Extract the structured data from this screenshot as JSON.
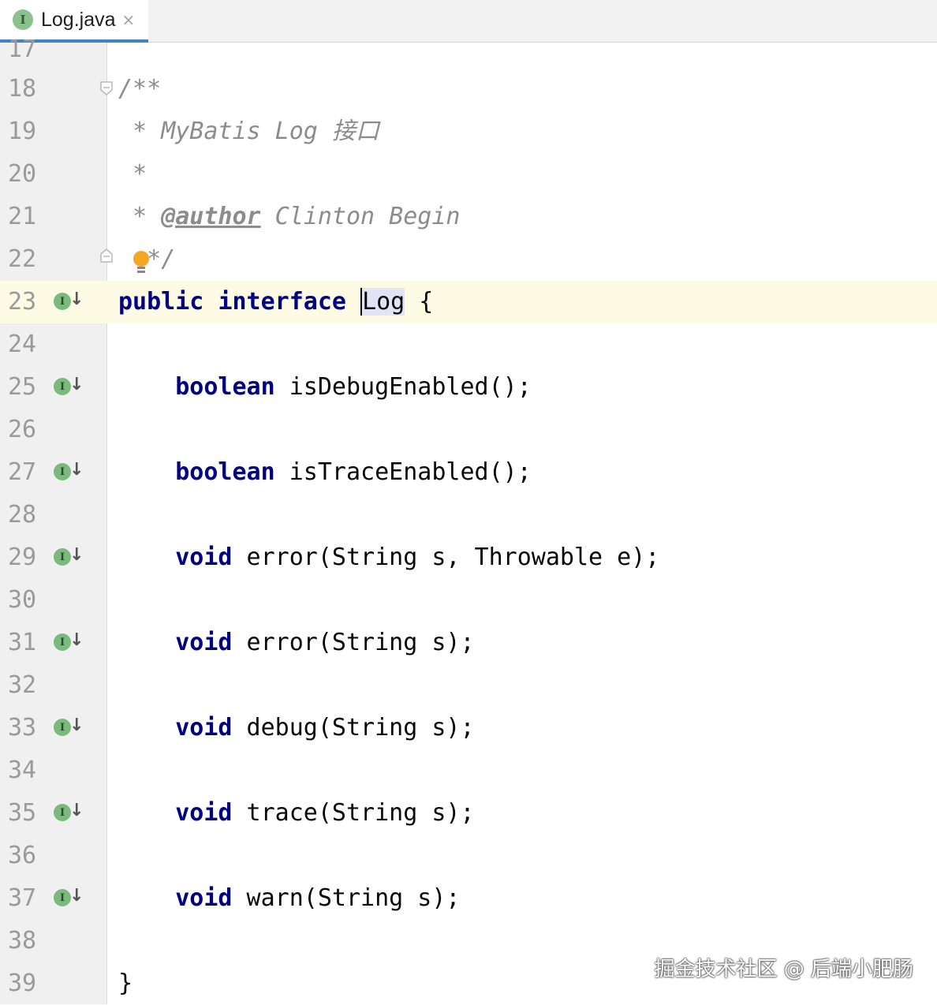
{
  "tab": {
    "icon_letter": "I",
    "title": "Log.java",
    "close_glyph": "×"
  },
  "gutter": {
    "impl_icon_letter": "I",
    "impl_arrow": "↓"
  },
  "lines": [
    {
      "num": "17",
      "code": ""
    },
    {
      "num": "18",
      "code": "/**"
    },
    {
      "num": "19",
      "code": " * MyBatis Log 接口"
    },
    {
      "num": "20",
      "code": " *"
    },
    {
      "num": "21",
      "code": " * @author Clinton Begin"
    },
    {
      "num": "22",
      "code": " */"
    },
    {
      "num": "23",
      "code": "public interface Log {"
    },
    {
      "num": "24",
      "code": ""
    },
    {
      "num": "25",
      "code": "    boolean isDebugEnabled();"
    },
    {
      "num": "26",
      "code": ""
    },
    {
      "num": "27",
      "code": "    boolean isTraceEnabled();"
    },
    {
      "num": "28",
      "code": ""
    },
    {
      "num": "29",
      "code": "    void error(String s, Throwable e);"
    },
    {
      "num": "30",
      "code": ""
    },
    {
      "num": "31",
      "code": "    void error(String s);"
    },
    {
      "num": "32",
      "code": ""
    },
    {
      "num": "33",
      "code": "    void debug(String s);"
    },
    {
      "num": "34",
      "code": ""
    },
    {
      "num": "35",
      "code": "    void trace(String s);"
    },
    {
      "num": "36",
      "code": ""
    },
    {
      "num": "37",
      "code": "    void warn(String s);"
    },
    {
      "num": "38",
      "code": ""
    },
    {
      "num": "39",
      "code": "}"
    }
  ],
  "code_tokens": {
    "comment_open": "/**",
    "comment_star": " * ",
    "comment_title": "MyBatis Log 接口",
    "comment_blank": " *",
    "author_tag": "@author",
    "author_name": " Clinton Begin",
    "comment_close_star": "*",
    "comment_close_slash": "/",
    "kw_public": "public",
    "kw_interface": "interface",
    "interface_name": "Log",
    "open_brace": " {",
    "close_brace": "}",
    "kw_boolean": "boolean",
    "kw_void": "void",
    "m_isDebugEnabled": " isDebugEnabled();",
    "m_isTraceEnabled": " isTraceEnabled();",
    "m_error2": " error(String s, Throwable e);",
    "m_error1": " error(String s);",
    "m_debug": " debug(String s);",
    "m_trace": " trace(String s);",
    "m_warn": " warn(String s);"
  },
  "current_line": "23",
  "implemented_lines": [
    "23",
    "25",
    "27",
    "29",
    "31",
    "33",
    "35",
    "37"
  ],
  "watermark": "掘金技术社区 @ 后端小肥肠",
  "colors": {
    "keyword": "#000080",
    "comment": "#8c8c8c",
    "line_number": "#9a9a9a",
    "current_line_bg": "#fdfbe3",
    "selection": "#e2e3f7",
    "tab_underline": "#4083c9"
  }
}
